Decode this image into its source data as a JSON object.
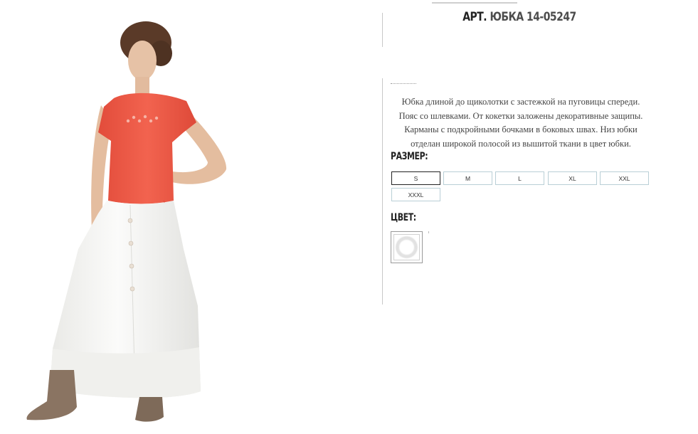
{
  "product": {
    "title_label": "АРТ.",
    "title_value": "ЮБКА 14-05247",
    "description_lines": [
      "Юбка длиной до щиколотки с застежкой на пуговицы спереди.",
      "Пояс со шлевками. От кокетки заложены декоративные защипы.",
      "Карманы с подкройными бочками в боковых швах. Низ юбки",
      "отделан широкой полосой из вышитой ткани в цвет юбки."
    ]
  },
  "size_section": {
    "label": "РАЗМЕР:",
    "options": [
      "S",
      "M",
      "L",
      "XL",
      "XXL",
      "XXXL"
    ],
    "selected": "S"
  },
  "color_section": {
    "label": "ЦВЕТ:",
    "swatch_color": "#ffffff"
  },
  "colors": {
    "top_coral": "#ec5a47",
    "skirt_white": "#f6f6f4",
    "boots_brown": "#8a7462",
    "size_border": "#b9cfd6"
  }
}
